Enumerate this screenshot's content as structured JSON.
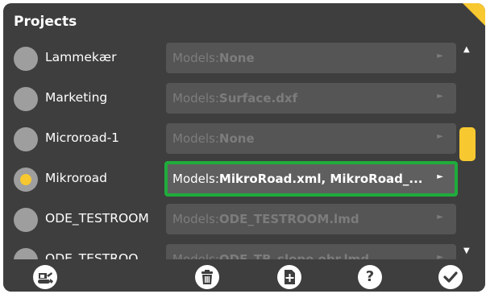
{
  "header": {
    "title": "Projects"
  },
  "projects": [
    {
      "name": "Lammekær",
      "models_prefix": "Models:",
      "models_value": "None",
      "selected": false
    },
    {
      "name": "Marketing",
      "models_prefix": "Models:",
      "models_value": "Surface.dxf",
      "selected": false
    },
    {
      "name": "Microroad-1",
      "models_prefix": "Models:",
      "models_value": "None",
      "selected": false
    },
    {
      "name": "Mikroroad",
      "models_prefix": "Models:",
      "models_value": "MikroRoad.xml,  MikroRoad_...",
      "selected": true
    },
    {
      "name": "ODE_TESTROOM",
      "models_prefix": "Models:",
      "models_value": "ODE_TESTROOM.lmd",
      "selected": false
    },
    {
      "name": "ODE_TESTROO",
      "models_prefix": "Models:",
      "models_value": "ODE_TB_slope obr.lmd",
      "selected": false
    }
  ],
  "scrollbar": {
    "up_icon": "triangle-up-icon",
    "down_icon": "triangle-down-icon",
    "thumb_color": "#f7c82f"
  },
  "toolbar": {
    "buttons": [
      {
        "icon": "machine-icon"
      },
      {
        "icon": "trash-icon"
      },
      {
        "icon": "add-file-icon"
      },
      {
        "icon": "help-icon",
        "glyph": "?"
      },
      {
        "icon": "checkmark-icon"
      }
    ]
  },
  "colors": {
    "background": "#3e3e3e",
    "accent": "#f7c82f",
    "selection_border": "#1fac3b",
    "button_bg": "#555555"
  }
}
